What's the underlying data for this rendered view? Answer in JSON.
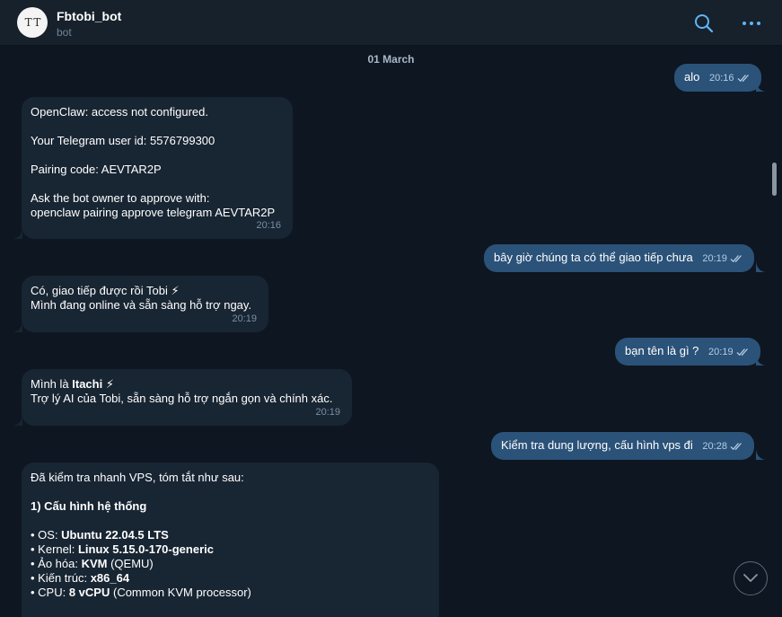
{
  "header": {
    "avatar_text": "T T",
    "name": "Fbtobi_bot",
    "status": "bot"
  },
  "chat": {
    "date_separator": "01 March",
    "messages": [
      {
        "dir": "out",
        "text": "alo",
        "time": "20:16"
      },
      {
        "dir": "in",
        "lines": [
          "OpenClaw: access not configured.",
          "Your Telegram user id: 5576799300",
          "Pairing code: AEVTAR2P",
          "Ask the bot owner to approve with:",
          "openclaw pairing approve telegram AEVTAR2P"
        ],
        "time": "20:16"
      },
      {
        "dir": "out",
        "text": "bây giờ chúng ta có thể giao tiếp chưa",
        "time": "20:19"
      },
      {
        "dir": "in",
        "lines": [
          "Có, giao tiếp được rồi Tobi ⚡",
          "Mình đang online và sẵn sàng hỗ trợ ngay."
        ],
        "time": "20:19"
      },
      {
        "dir": "out",
        "text": "bạn tên là gì ?",
        "time": "20:19"
      },
      {
        "dir": "in",
        "line1_prefix": "Mình là ",
        "line1_bold": "Itachi",
        "line1_suffix": " ⚡",
        "line2": "Trợ lý AI của Tobi, sẵn sàng hỗ trợ ngắn gọn và chính xác.",
        "time": "20:19"
      },
      {
        "dir": "out",
        "text": "Kiểm tra dung lượng, cấu hình vps đi",
        "time": "20:28"
      },
      {
        "dir": "in",
        "intro": "Đã kiểm tra nhanh VPS, tóm tắt như sau:",
        "section_title": "1) Cấu hình hệ thống",
        "items": [
          {
            "label": "• OS: ",
            "value": "Ubuntu 22.04.5 LTS",
            "extra": ""
          },
          {
            "label": "• Kernel: ",
            "value": "Linux 5.15.0-170-generic",
            "extra": ""
          },
          {
            "label": "• Ảo hóa: ",
            "value": "KVM",
            "extra": " (QEMU)"
          },
          {
            "label": "• Kiến trúc: ",
            "value": "x86_64",
            "extra": ""
          },
          {
            "label": "• CPU: ",
            "value": "8 vCPU",
            "extra": " (Common KVM processor)"
          }
        ]
      }
    ]
  },
  "colors": {
    "background": "#0e1621",
    "header": "#17212b",
    "incoming_bubble": "#182533",
    "outgoing_bubble": "#2b5278",
    "accent": "#5eb5f7"
  },
  "icons": {
    "search": "search-icon",
    "more": "more-icon",
    "read_receipt": "double-check-icon",
    "scroll_down": "chevron-down-icon"
  }
}
